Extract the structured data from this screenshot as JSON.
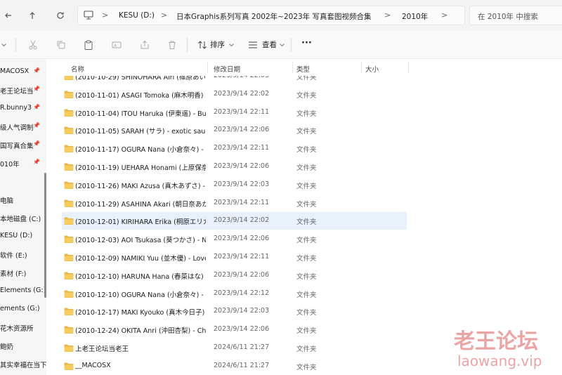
{
  "addressbar": {
    "crumbs": [
      "KESU (D:)",
      "日本Graphis系列写真 2002年~2023年 写真套图视频合集",
      "2010年"
    ],
    "separator": ">"
  },
  "search": {
    "placeholder": "在 2010年 中搜索"
  },
  "toolbar": {
    "sort_label": "排序",
    "view_label": "查看",
    "more_label": "···"
  },
  "sidebar": {
    "items": [
      {
        "label": "MACOSX",
        "pinned": true
      },
      {
        "label": "老王论坛当",
        "pinned": true
      },
      {
        "label": "R.bunny3",
        "pinned": true
      },
      {
        "label": "级人气调制",
        "pinned": true
      },
      {
        "label": "国写真合集",
        "pinned": true
      },
      {
        "label": "010年",
        "pinned": true
      },
      {
        "label": "电脑",
        "pinned": false
      },
      {
        "label": "本地磁盘 (C:)",
        "pinned": false
      },
      {
        "label": "KESU (D:)",
        "pinned": false
      },
      {
        "label": "软件 (E:)",
        "pinned": false
      },
      {
        "label": "素材 (F:)",
        "pinned": false
      },
      {
        "label": "Elements (G:)",
        "pinned": false
      },
      {
        "label": "ements (G:)",
        "pinned": false
      },
      {
        "label": "花木资源所",
        "pinned": false
      },
      {
        "label": "鲍奶",
        "pinned": false
      },
      {
        "label": "其实幸福在当下",
        "pinned": false
      }
    ],
    "pin_glyph": "📌"
  },
  "columns": {
    "name": "名称",
    "date": "修改日期",
    "type": "类型",
    "size": "大小"
  },
  "files": [
    {
      "name": "(2010-10-29) SHINOHARA Airi (篠原あいり)",
      "date": "2023/9/14 22:03",
      "type": "文件夹"
    },
    {
      "name": "(2010-11-01) ASAGI Tomoka (麻木明香) -",
      "date": "2023/9/14 22:02",
      "type": "文件夹"
    },
    {
      "name": "(2010-11-04) ITOU Haruka (伊東遥) - Bu",
      "date": "2023/9/14 22:11",
      "type": "文件夹"
    },
    {
      "name": "(2010-11-05) SARAH (サラ) - exotic sauce",
      "date": "2023/9/14 22:06",
      "type": "文件夹"
    },
    {
      "name": "(2010-11-17) OGURA Nana (小倉奈々) - U",
      "date": "2023/9/14 22:11",
      "type": "文件夹"
    },
    {
      "name": "(2010-11-19) UEHARA Honami (上原保奈",
      "date": "2023/9/14 22:06",
      "type": "文件夹"
    },
    {
      "name": "(2010-11-26) MAKI Azusa (真木あずさ) -",
      "date": "2023/9/14 22:03",
      "type": "文件夹"
    },
    {
      "name": "(2010-11-29) ASAHINA Akari (朝日奈あか",
      "date": "2023/9/14 22:11",
      "type": "文件夹"
    },
    {
      "name": "(2010-12-01) KIRIHARA Erika (桐原エリカ",
      "date": "2023/9/14 22:02",
      "type": "文件夹"
    },
    {
      "name": "(2010-12-03) AOI Tsukasa (葵つかさ) - N",
      "date": "2023/9/14 22:06",
      "type": "文件夹"
    },
    {
      "name": "(2010-12-09) NAMIKI Yuu (並木優) - Love",
      "date": "2023/9/14 22:11",
      "type": "文件夹"
    },
    {
      "name": "(2010-12-10) HARUNA Hana (春菜はな) -",
      "date": "2023/9/14 22:06",
      "type": "文件夹"
    },
    {
      "name": "(2010-12-10) OGURA Nana (小倉奈々) - G",
      "date": "2023/9/14 22:12",
      "type": "文件夹"
    },
    {
      "name": "(2010-12-17) MAKI Kyouko (真木今日子)",
      "date": "2023/9/14 22:03",
      "type": "文件夹"
    },
    {
      "name": "(2010-12-24) OKITA Anri (沖田杏梨) - Ch",
      "date": "2023/9/14 22:06",
      "type": "文件夹"
    },
    {
      "name": "上老王论坛当老王",
      "date": "2024/6/11 21:27",
      "type": "文件夹"
    },
    {
      "name": "__MACOSX",
      "date": "2024/6/11 21:27",
      "type": "文件夹"
    }
  ],
  "selected_index": 8,
  "watermark": {
    "line1": "老王论坛",
    "line2": "laowang.vip"
  },
  "colors": {
    "folder": "#e8b84a",
    "selection": "#e8f0fa",
    "watermark": "#e99b9b"
  }
}
